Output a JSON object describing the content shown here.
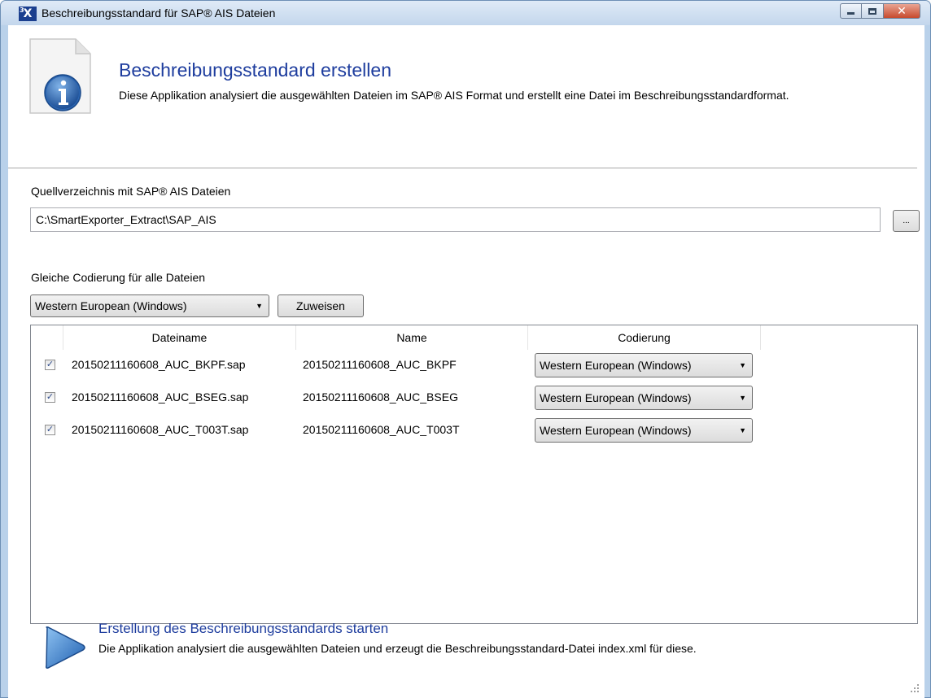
{
  "window": {
    "title": "Beschreibungsstandard für SAP® AIS Dateien",
    "icon_label": "X",
    "icon_superscript": "3"
  },
  "header": {
    "title": "Beschreibungsstandard erstellen",
    "description": "Diese Applikation analysiert die ausgewählten Dateien im SAP® AIS Format und erstellt eine Datei im Beschreibungsstandardformat."
  },
  "source": {
    "label": "Quellverzeichnis mit SAP® AIS Dateien",
    "path": "C:\\SmartExporter_Extract\\SAP_AIS",
    "browse_label": "..."
  },
  "encoding": {
    "label": "Gleiche Codierung für alle Dateien",
    "selected": "Western European (Windows)",
    "assign_label": "Zuweisen"
  },
  "table": {
    "columns": [
      "Dateiname",
      "Name",
      "Codierung"
    ],
    "rows": [
      {
        "checked": true,
        "filename": "20150211160608_AUC_BKPF.sap",
        "name": "20150211160608_AUC_BKPF",
        "encoding": "Western European (Windows)"
      },
      {
        "checked": true,
        "filename": "20150211160608_AUC_BSEG.sap",
        "name": "20150211160608_AUC_BSEG",
        "encoding": "Western European (Windows)"
      },
      {
        "checked": true,
        "filename": "20150211160608_AUC_T003T.sap",
        "name": "20150211160608_AUC_T003T",
        "encoding": "Western European (Windows)"
      }
    ]
  },
  "start": {
    "link": "Erstellung des Beschreibungsstandards starten",
    "description": "Die Applikation analysiert die ausgewählten Dateien und erzeugt die Beschreibungsstandard-Datei index.xml für diese."
  },
  "colors": {
    "accent": "#1e3d9e",
    "title_bar": "#c3d6ec",
    "close_button": "#c74a2d"
  }
}
